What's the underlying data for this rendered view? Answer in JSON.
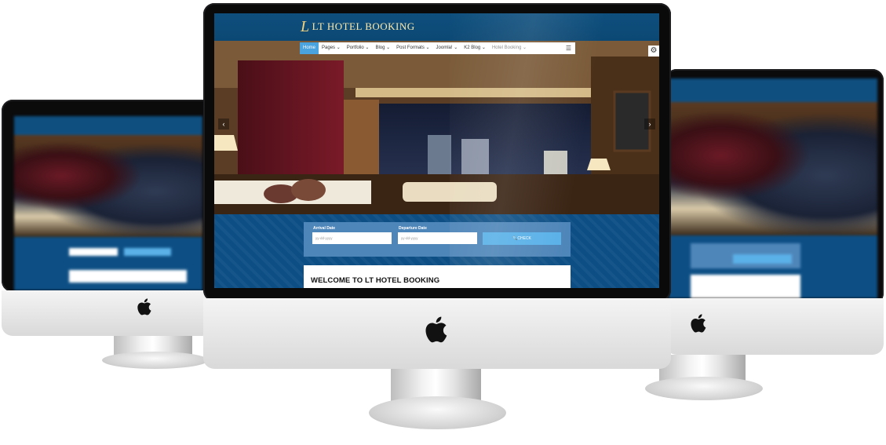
{
  "site": {
    "logo_mark": "L",
    "logo_text": "LT HOTEL BOOKING",
    "nav": [
      {
        "label": "Home",
        "active": true
      },
      {
        "label": "Pages ⌄"
      },
      {
        "label": "Portfolio ⌄"
      },
      {
        "label": "Blog ⌄"
      },
      {
        "label": "Post Formats ⌄"
      },
      {
        "label": "Joomla! ⌄"
      },
      {
        "label": "K2 Blog ⌄"
      },
      {
        "label": "Hotel Booking ⌄"
      }
    ],
    "menu_icon": "☰",
    "settings_icon": "⚙",
    "slider": {
      "prev_icon": "‹",
      "next_icon": "›"
    },
    "booking": {
      "arrival_label": "Arrival Date",
      "arrival_placeholder": "yy-dd-yyyy",
      "departure_label": "Departure Date",
      "departure_placeholder": "yy-dd-yyyy",
      "check_label": "🔍CHECK"
    },
    "welcome_title": "WELCOME TO LT HOTEL BOOKING"
  },
  "colors": {
    "brand_blue": "#0d4f85",
    "accent_blue": "#4aa3df",
    "button_blue": "#5ab1e8"
  }
}
